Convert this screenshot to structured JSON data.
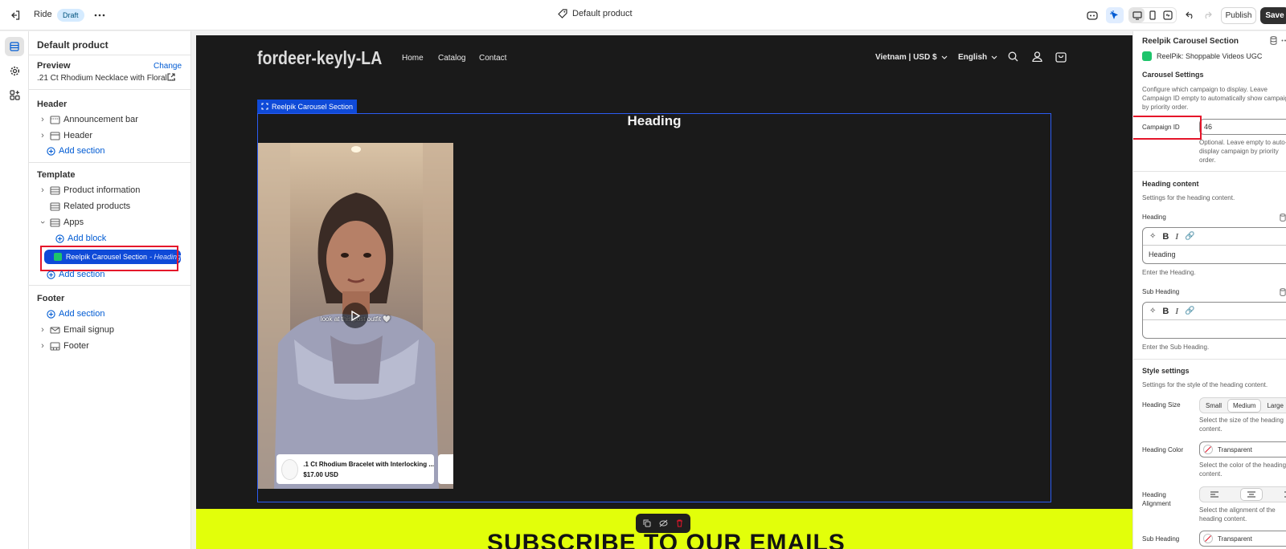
{
  "topbar": {
    "theme_name": "Ride",
    "status_badge": "Draft",
    "template_title": "Default product",
    "publish_label": "Publish",
    "save_label": "Save"
  },
  "left_panel": {
    "title": "Default product",
    "preview": {
      "label": "Preview",
      "change_label": "Change",
      "product_name": ".21 Ct Rhodium Necklace with Floral ..."
    },
    "header_group": {
      "title": "Header",
      "items": [
        "Announcement bar",
        "Header"
      ],
      "add_section": "Add section"
    },
    "template_group": {
      "title": "Template",
      "items": [
        "Product information",
        "Related products",
        "Apps"
      ],
      "add_block": "Add block",
      "selected_block": "Reelpik Carousel Section",
      "selected_block_suffix": "- Heading",
      "add_section": "Add section"
    },
    "footer_group": {
      "title": "Footer",
      "add_section": "Add section",
      "items": [
        "Email signup",
        "Footer"
      ]
    }
  },
  "store": {
    "logo": "fordeer-keyly-LA",
    "nav": [
      "Home",
      "Catalog",
      "Contact"
    ],
    "currency": "Vietnam | USD $",
    "language": "English",
    "section_tag": "Reelpik Carousel Section",
    "heading": "Heading",
    "video_caption": "look at this post outfit 🤍",
    "product_name": ".1 Ct Rhodium Bracelet with Interlocking ...",
    "product_price": "$17.00 USD",
    "subscribe_text": "SUBSCRIBE TO OUR EMAILS",
    "accent_color": "#e2ff0a"
  },
  "right_panel": {
    "section_title": "Reelpik Carousel Section",
    "app_name": "ReelPik: Shoppable Videos UGC",
    "carousel_settings": {
      "title": "Carousel Settings",
      "description": "Configure which campaign to display. Leave Campaign ID empty to automatically show campaign by priority order.",
      "campaign_id_label": "Campaign ID",
      "campaign_id_value": "46",
      "campaign_id_help": "Optional. Leave empty to auto-display campaign by priority order."
    },
    "heading_content": {
      "title": "Heading content",
      "description": "Settings for the heading content.",
      "heading_label": "Heading",
      "heading_value": "Heading",
      "heading_help": "Enter the Heading.",
      "sub_heading_label": "Sub Heading",
      "sub_heading_value": "",
      "sub_heading_help": "Enter the Sub Heading."
    },
    "style_settings": {
      "title": "Style settings",
      "description": "Settings for the style of the heading content.",
      "heading_size_label": "Heading Size",
      "size_options": [
        "Small",
        "Medium",
        "Large"
      ],
      "size_selected": "Medium",
      "heading_size_help": "Select the size of the heading content.",
      "heading_color_label": "Heading Color",
      "heading_color_value": "Transparent",
      "heading_color_help": "Select the color of the heading content.",
      "heading_alignment_label": "Heading Alignment",
      "heading_alignment_help": "Select the alignment of the heading content.",
      "sub_heading_color_label": "Sub Heading",
      "sub_heading_color_value": "Transparent"
    }
  },
  "colors": {
    "highlight_red": "#e5152a",
    "selection_blue": "#0f4ad8",
    "link_blue": "#005bd3"
  }
}
